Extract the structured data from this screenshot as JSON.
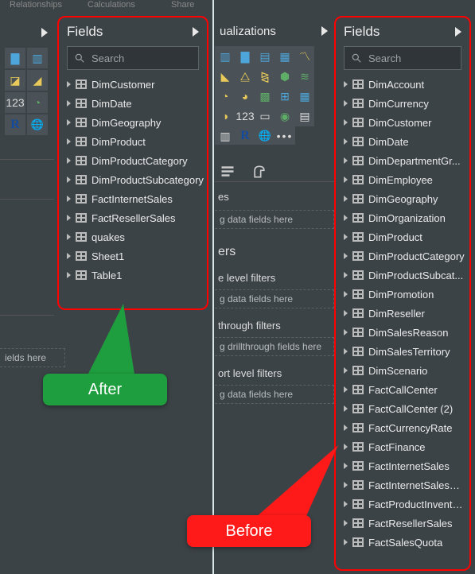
{
  "ribbon": {
    "relationships": "Relationships",
    "calculations": "Calculations",
    "share": "Share"
  },
  "headers": {
    "visualizations": "ualizations",
    "fields": "Fields"
  },
  "search": {
    "placeholder": "Search"
  },
  "left_fields": [
    "DimCustomer",
    "DimDate",
    "DimGeography",
    "DimProduct",
    "DimProductCategory",
    "DimProductSubcategory",
    "FactInternetSales",
    "FactResellerSales",
    "quakes",
    "Sheet1",
    "Table1"
  ],
  "right_fields": [
    "DimAccount",
    "DimCurrency",
    "DimCustomer",
    "DimDate",
    "DimDepartmentGr...",
    "DimEmployee",
    "DimGeography",
    "DimOrganization",
    "DimProduct",
    "DimProductCategory",
    "DimProductSubcat...",
    "DimPromotion",
    "DimReseller",
    "DimSalesReason",
    "DimSalesTerritory",
    "DimScenario",
    "FactCallCenter",
    "FactCallCenter (2)",
    "FactCurrencyRate",
    "FactFinance",
    "FactInternetSales",
    "FactInternetSalesRe...",
    "FactProductInventory",
    "FactResellerSales",
    "FactSalesQuota"
  ],
  "wells": {
    "fields_here_left": "ields here",
    "data_fields_1": "g data fields here",
    "filters_header": "ers",
    "level_filters": "e level filters",
    "data_fields_2": "g data fields here",
    "through_filters": "through filters",
    "drillthrough": "g drillthrough fields here",
    "report_level": "ort level filters",
    "data_fields_3": "g data fields here"
  },
  "callouts": {
    "after": "After",
    "before": "Before"
  },
  "viz_icons_left": [
    [
      "bar-h",
      "bar-v"
    ],
    [
      "col",
      "area"
    ],
    [
      "pie",
      "kpi"
    ],
    [
      "r",
      "globe"
    ]
  ],
  "viz_icons_mid": [
    [
      "bar",
      "sbar",
      "col",
      "scol",
      "line",
      "area"
    ],
    [
      "sarea",
      "combo",
      "scombo",
      "ribbon",
      "water",
      "scatter"
    ],
    [
      "pie",
      "donut",
      "tree",
      "map",
      "fmap",
      "funnel"
    ],
    [
      "gauge",
      "card",
      "mcard",
      "kpi",
      "slicer",
      "table"
    ],
    [
      "matrix",
      "r",
      "py",
      "dots",
      "",
      ""
    ]
  ]
}
